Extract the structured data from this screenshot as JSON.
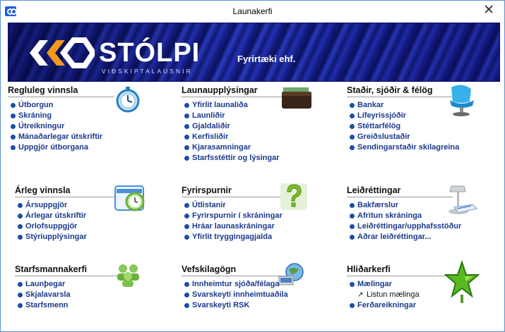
{
  "window": {
    "title": "Launakerfi",
    "close_glyph": "✕"
  },
  "banner": {
    "logo_text": "STÓLPI",
    "logo_sub": "VIÐSKIPTALAUSNIR",
    "company": "Fyrirtæki ehf."
  },
  "sections": {
    "regluleg": {
      "title": "Regluleg vinnsla",
      "items": [
        "Útborgun",
        "Skráning",
        "Útreikningur",
        "Mánaðarlegar útskriftir",
        "Uppgjör útborgana"
      ]
    },
    "launauppl": {
      "title": "Launaupplýsingar",
      "items": [
        "Yfirlit launaliða",
        "Launliðir",
        "Gjaldaliðir",
        "Kerfisliðir",
        "Kjarasamningar",
        "Starfsstéttir og lýsingar"
      ]
    },
    "stadir": {
      "title": "Staðir, sjóðir & félög",
      "items": [
        "Bankar",
        "Lífeyrissjóðir",
        "Stéttarfélög",
        "Greiðslustaðir",
        "Sendingarstaðir skilagreina"
      ]
    },
    "arleg": {
      "title": "Árleg vinnsla",
      "items": [
        "Ársuppgjör",
        "Árlegar útskriftir",
        "Orlofsuppgjör",
        "Stýriupplýsingar"
      ]
    },
    "fyrirspurnir": {
      "title": "Fyrirspurnir",
      "items": [
        "Útlistanir",
        "Fyrirspurnir í skráningar",
        "Hráar launaskráningar",
        "Yfirlit tryggingagjalda"
      ]
    },
    "leidrettingar": {
      "title": "Leiðréttingar",
      "items": [
        "Bakfærslur",
        "Afritun skráninga",
        "Leiðréttingar/upphafsstöður",
        "Aðrar leiðréttingar..."
      ]
    },
    "starfsmanna": {
      "title": "Starfsmannakerfi",
      "items": [
        "Launþegar",
        "Skjalavarsla",
        "Starfsmenn"
      ]
    },
    "vefskil": {
      "title": "Vefskilagögn",
      "items": [
        "Innheimtur sjóða/félaga",
        "Svarskeyti innheimtuaðila",
        "Svarskeyti RSK"
      ]
    },
    "hlidar": {
      "title": "Hliðarkerfi",
      "items": [
        "Mælingar",
        "Listun mælinga",
        "Ferðareikningar"
      ]
    }
  },
  "icons": {
    "regluleg": "stopwatch-icon",
    "launauppl": "wallet-icon",
    "stadir": "chair-icon",
    "arleg": "alarm-clock-icon",
    "fyrirspurnir": "question-mark-icon",
    "leidrettingar": "desk-lamp-icon",
    "starfsmanna": "users-icon",
    "vefskil": "globe-icon",
    "hlidar": "star-icon"
  },
  "colors": {
    "link": "#1a3a8c",
    "bullet": "#1b4ea8",
    "banner": "#1a249a"
  }
}
